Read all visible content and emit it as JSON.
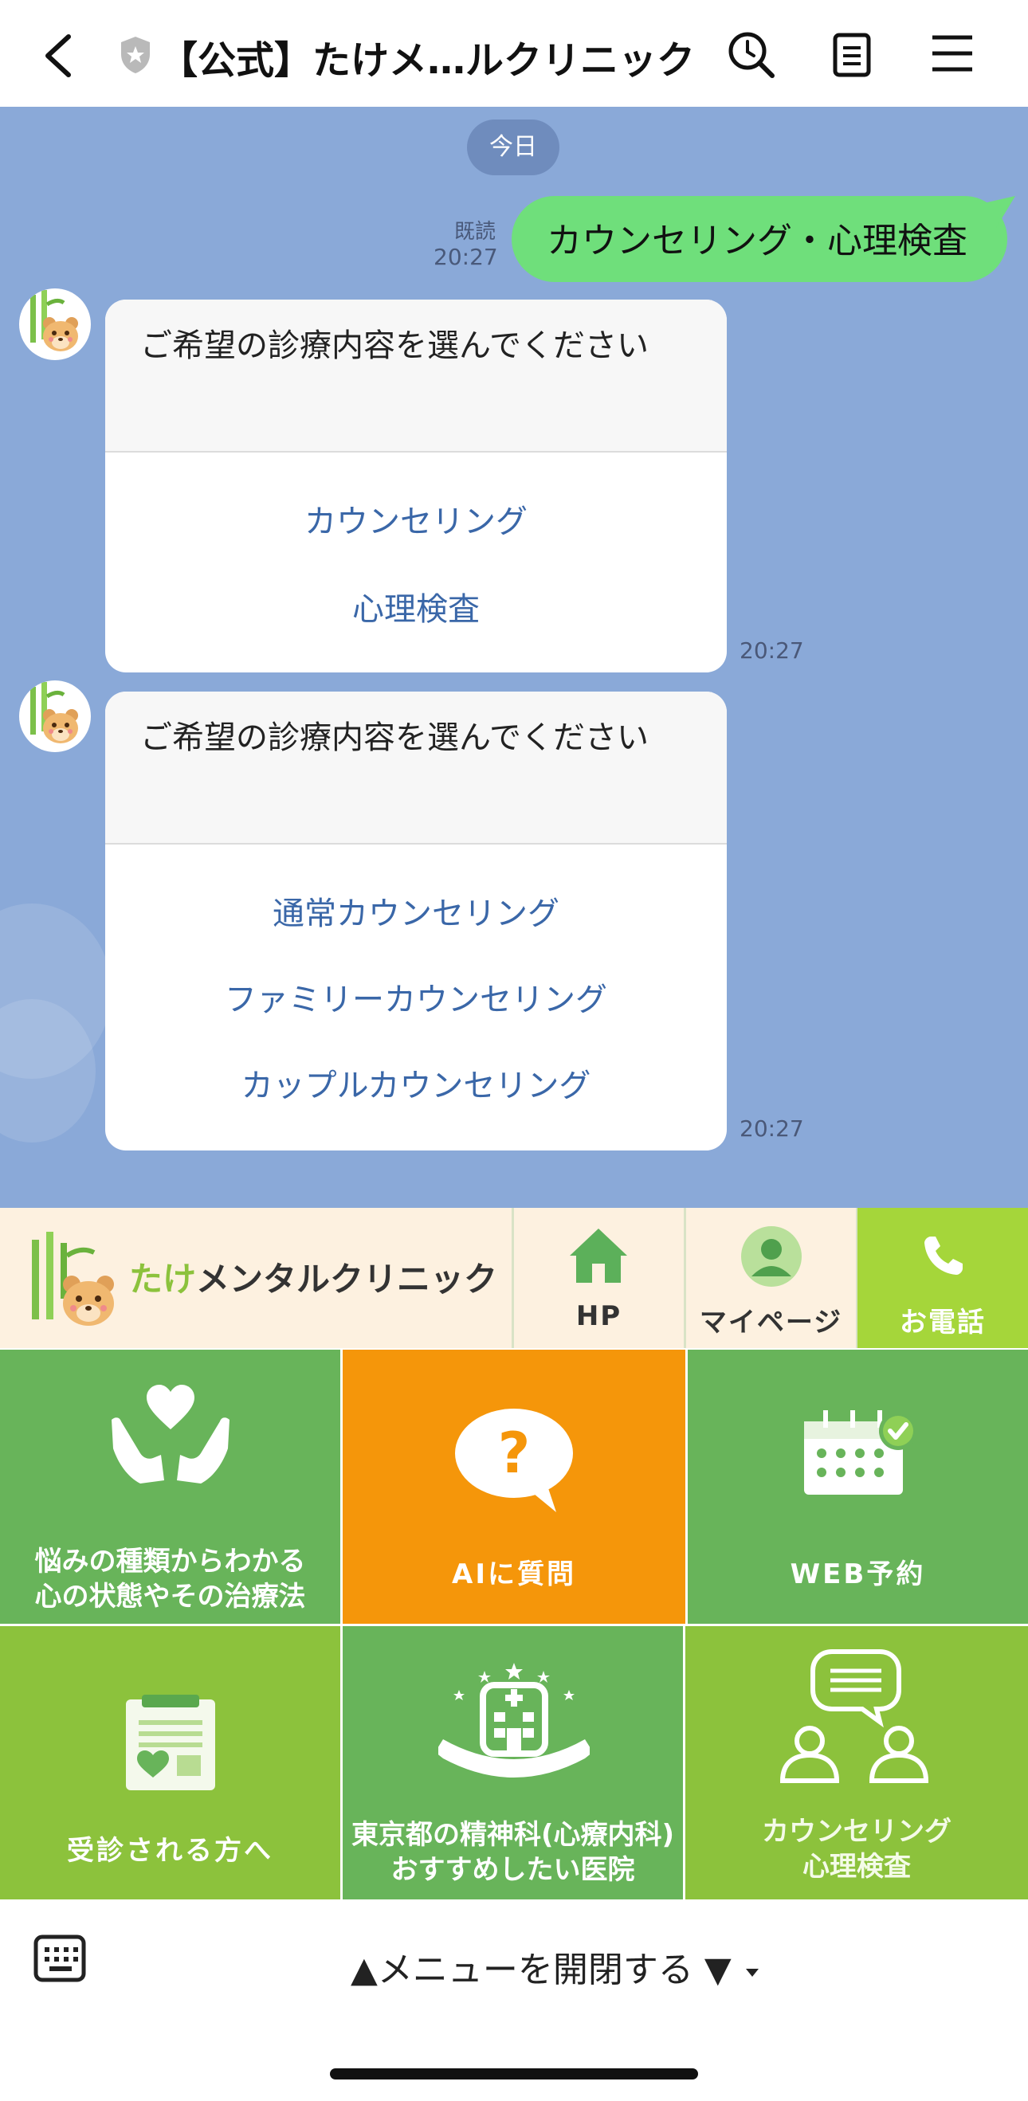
{
  "header": {
    "title": "【公式】たけメ…ルクリニック"
  },
  "chat": {
    "date_label": "今日",
    "outgoing": {
      "text": "カウンセリング・心理検査",
      "read_label": "既読",
      "time": "20:27"
    },
    "bot_messages": [
      {
        "prompt": "ご希望の診療内容を選んでください",
        "options": [
          "カウンセリング",
          "心理検査"
        ],
        "time": "20:27"
      },
      {
        "prompt": "ご希望の診療内容を選んでください",
        "options": [
          "通常カウンセリング",
          "ファミリーカウンセリング",
          "カップルカウンセリング"
        ],
        "time": "20:27"
      }
    ]
  },
  "rich_menu": {
    "brand": {
      "part1": "たけ",
      "part2": "メンタルクリニック"
    },
    "top_buttons": [
      {
        "label": "HP",
        "icon": "home-icon"
      },
      {
        "label": "マイページ",
        "icon": "person-icon"
      },
      {
        "label": "お電話",
        "icon": "phone-icon"
      }
    ],
    "tiles": [
      {
        "label": "悩みの種類からわかる\n心の状態やその治療法",
        "icon": "hands-heart-icon",
        "color": "#68b45a"
      },
      {
        "label": "AIに質問",
        "icon": "question-bubble-icon",
        "color": "#f5960a"
      },
      {
        "label": "WEB予約",
        "icon": "calendar-check-icon",
        "color": "#68b45a"
      },
      {
        "label": "受診される方へ",
        "icon": "clipboard-icon",
        "color": "#8cc23c"
      },
      {
        "label": "東京都の精神科(心療内科)\nおすすめしたい医院",
        "icon": "hospital-award-icon",
        "color": "#68b45a"
      },
      {
        "label": "カウンセリング\n心理検査",
        "icon": "counseling-people-icon",
        "color": "#8cc23c"
      }
    ]
  },
  "bottom": {
    "menu_toggle": "▲メニューを開閉する ▼"
  },
  "colors": {
    "chat_background": "#8aa9d8",
    "outgoing_bubble": "#6fdf7b",
    "option_link": "#3a67a8",
    "tile_green": "#68b45a",
    "tile_orange": "#f5960a",
    "tile_lime": "#8cc23c",
    "phone_green": "#a5d63a"
  }
}
